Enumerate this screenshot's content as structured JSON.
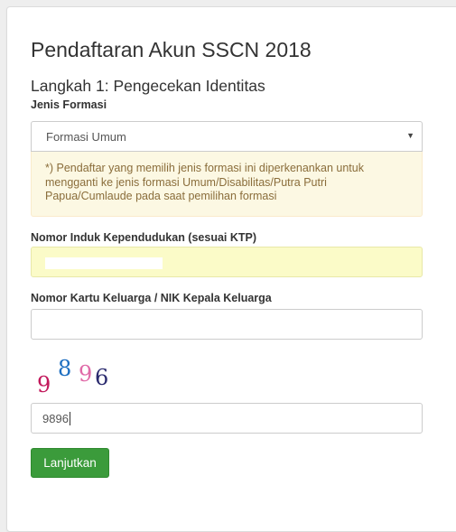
{
  "form": {
    "title": "Pendaftaran Akun SSCN 2018",
    "step_title": "Langkah 1: Pengecekan Identitas"
  },
  "formasi": {
    "label": "Jenis Formasi",
    "selected": "Formasi Umum",
    "note": "*) Pendaftar yang memilih jenis formasi ini diperkenankan untuk mengganti ke jenis formasi Umum/Disabilitas/Putra Putri Papua/Cumlaude pada saat pemilihan formasi"
  },
  "nik": {
    "label": "Nomor Induk Kependudukan (sesuai KTP)",
    "value": ""
  },
  "kk": {
    "label": "Nomor Kartu Keluarga / NIK Kepala Keluarga",
    "value": ""
  },
  "captcha": {
    "digits": [
      "9",
      "8",
      "9",
      "6"
    ],
    "colors": [
      "#c2185b",
      "#1e6fc1",
      "#e06aa8",
      "#2a2a6e"
    ],
    "input_value": "9896"
  },
  "submit": {
    "label": "Lanjutkan",
    "color": "#3b9b3b"
  }
}
